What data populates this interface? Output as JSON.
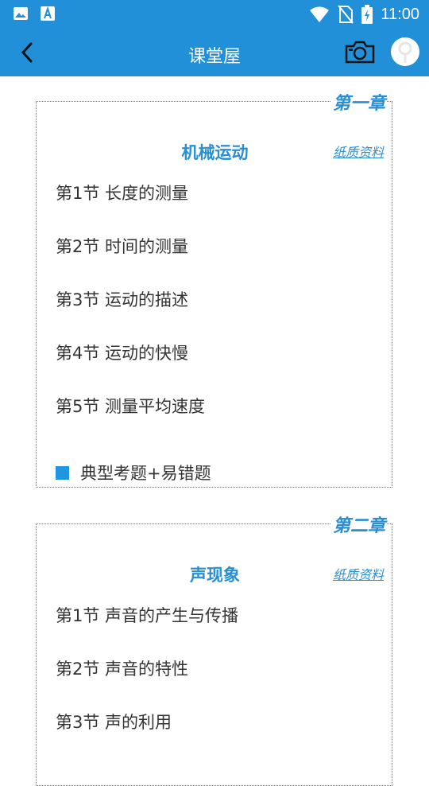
{
  "status_bar": {
    "time": "11:00",
    "icons": [
      "image-icon",
      "font-app-icon",
      "wifi-icon",
      "no-sim-icon",
      "battery-icon"
    ]
  },
  "header": {
    "title": "课堂屋",
    "icons": [
      "back-icon",
      "camera-icon",
      "avatar"
    ]
  },
  "chapters": [
    {
      "tag": "第一章",
      "title": "机械运动",
      "link": "纸质资料",
      "sections": [
        "第1节 长度的测量",
        "第2节 时间的测量",
        "第3节 运动的描述",
        "第4节 运动的快慢",
        "第5节 测量平均速度"
      ],
      "extra": "典型考题+易错题"
    },
    {
      "tag": "第二章",
      "title": "声现象",
      "link": "纸质资料",
      "sections": [
        "第1节 声音的产生与传播",
        "第2节 声音的特性",
        "第3节 声的利用"
      ]
    }
  ],
  "colors": {
    "primary": "#2190d8",
    "accent": "#2a8ed2",
    "text": "#333333"
  }
}
